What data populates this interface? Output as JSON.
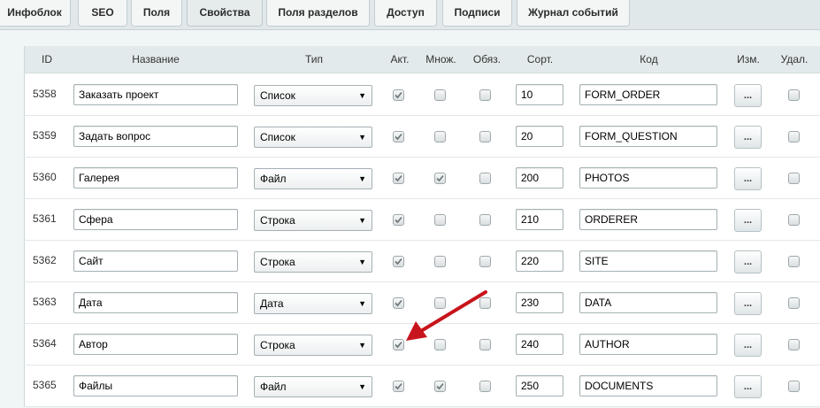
{
  "tabs": [
    "Инфоблок",
    "SEO",
    "Поля",
    "Свойства",
    "Поля разделов",
    "Доступ",
    "Подписи",
    "Журнал событий"
  ],
  "active_tab": "Свойства",
  "columns": {
    "id": "ID",
    "name": "Название",
    "type": "Тип",
    "active": "Акт.",
    "multiple": "Множ.",
    "required": "Обяз.",
    "sort": "Сорт.",
    "code": "Код",
    "edit": "Изм.",
    "delete": "Удал."
  },
  "edit_button_label": "...",
  "rows": [
    {
      "id": "5358",
      "name": "Заказать проект",
      "type": "Список",
      "active": true,
      "multiple": false,
      "required": false,
      "sort": "10",
      "code": "FORM_ORDER",
      "delete": false
    },
    {
      "id": "5359",
      "name": "Задать вопрос",
      "type": "Список",
      "active": true,
      "multiple": false,
      "required": false,
      "sort": "20",
      "code": "FORM_QUESTION",
      "delete": false
    },
    {
      "id": "5360",
      "name": "Галерея",
      "type": "Файл",
      "active": true,
      "multiple": true,
      "required": false,
      "sort": "200",
      "code": "PHOTOS",
      "delete": false
    },
    {
      "id": "5361",
      "name": "Сфера",
      "type": "Строка",
      "active": true,
      "multiple": false,
      "required": false,
      "sort": "210",
      "code": "ORDERER",
      "delete": false
    },
    {
      "id": "5362",
      "name": "Сайт",
      "type": "Строка",
      "active": true,
      "multiple": false,
      "required": false,
      "sort": "220",
      "code": "SITE",
      "delete": false
    },
    {
      "id": "5363",
      "name": "Дата",
      "type": "Дата",
      "active": true,
      "multiple": false,
      "required": false,
      "sort": "230",
      "code": "DATA",
      "delete": false
    },
    {
      "id": "5364",
      "name": "Автор",
      "type": "Строка",
      "active": true,
      "multiple": false,
      "required": false,
      "sort": "240",
      "code": "AUTHOR",
      "delete": false
    },
    {
      "id": "5365",
      "name": "Файлы",
      "type": "Файл",
      "active": true,
      "multiple": true,
      "required": false,
      "sort": "250",
      "code": "DOCUMENTS",
      "delete": false
    }
  ],
  "annotation_color": "#c8141c"
}
